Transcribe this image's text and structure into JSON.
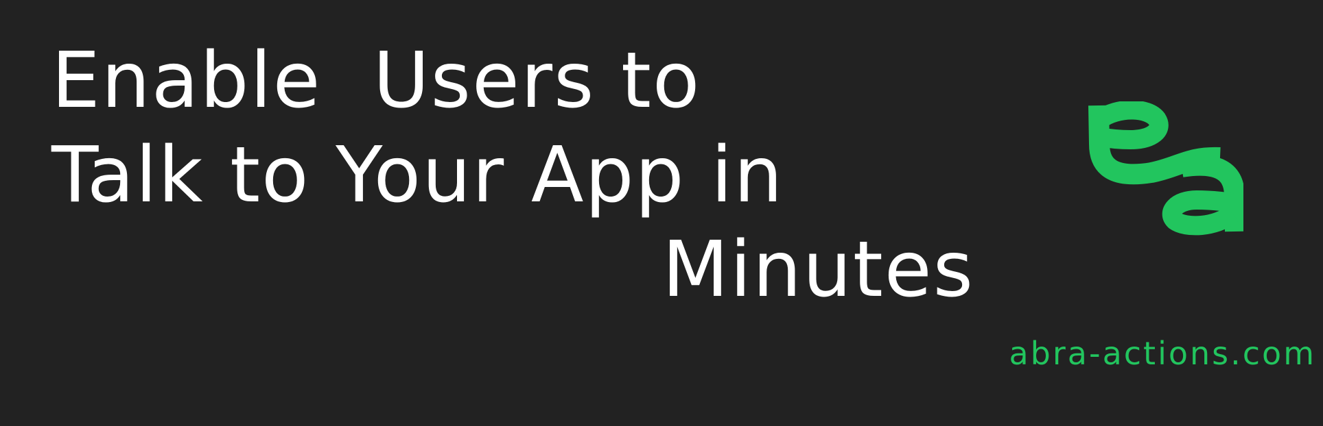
{
  "headline": {
    "line1": "Enable  Users to",
    "line2": "Talk to Your App in",
    "line3": "Minutes"
  },
  "brand": {
    "logo_icon": "abra-actions-logo-icon",
    "domain": "abra-actions.com",
    "accent_color": "#22c55e",
    "background_color": "#222222",
    "text_color": "#ffffff"
  }
}
